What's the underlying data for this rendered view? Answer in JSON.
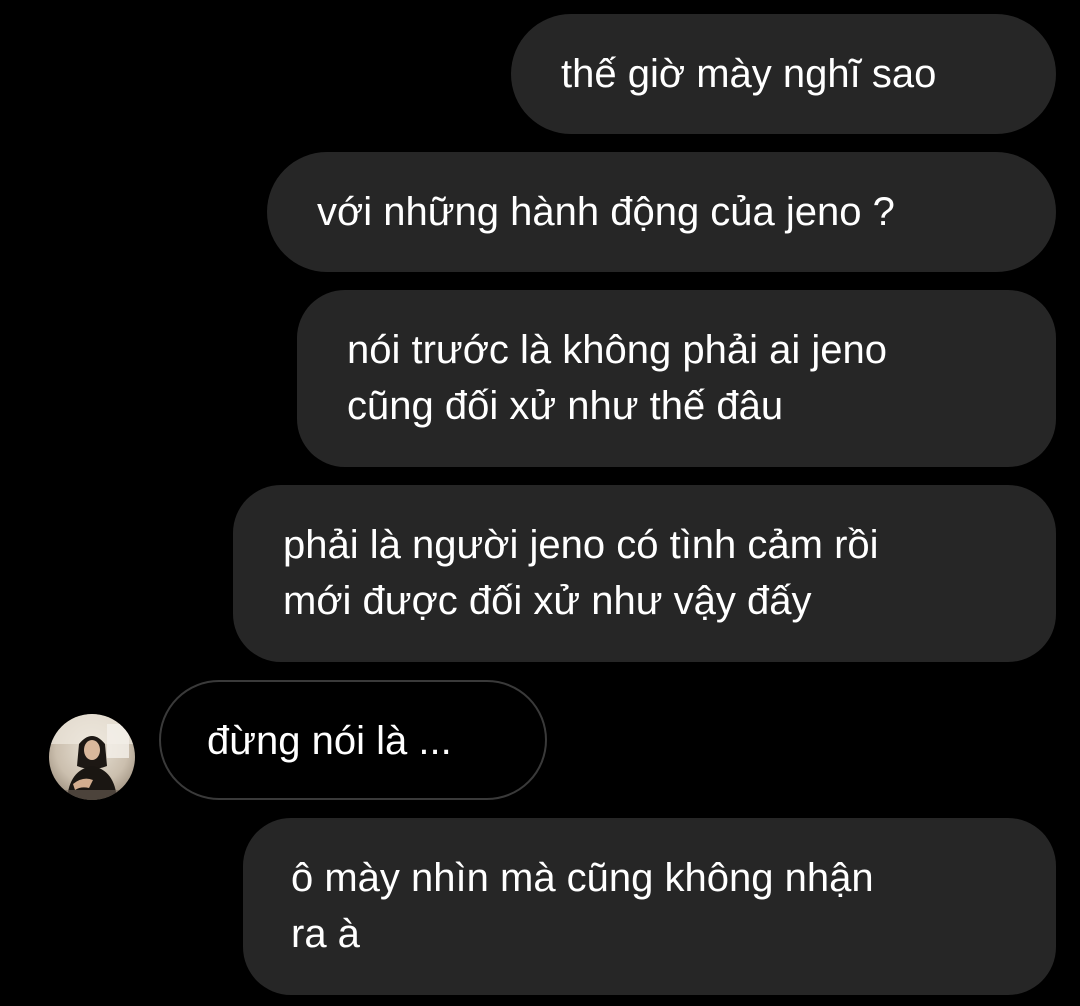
{
  "messages": [
    {
      "side": "outgoing",
      "text": "thế giờ mày nghĩ sao"
    },
    {
      "side": "outgoing",
      "text": "với những hành động của jeno ?"
    },
    {
      "side": "outgoing",
      "text": "nói trước là không phải ai jeno\ncũng đối xử như thế đâu"
    },
    {
      "side": "outgoing",
      "text": "phải là người jeno có tình cảm rồi\nmới được đối xử như vậy đấy"
    },
    {
      "side": "incoming",
      "text": "đừng nói là ..."
    },
    {
      "side": "outgoing",
      "text": "ô mày nhìn mà cũng không nhận\nra à"
    }
  ],
  "contact": {
    "avatar_icon": "profile-photo-avatar"
  },
  "colors": {
    "background": "#000000",
    "outgoing_bubble": "#262626",
    "incoming_border": "#3a3a3a",
    "text": "#ffffff"
  }
}
